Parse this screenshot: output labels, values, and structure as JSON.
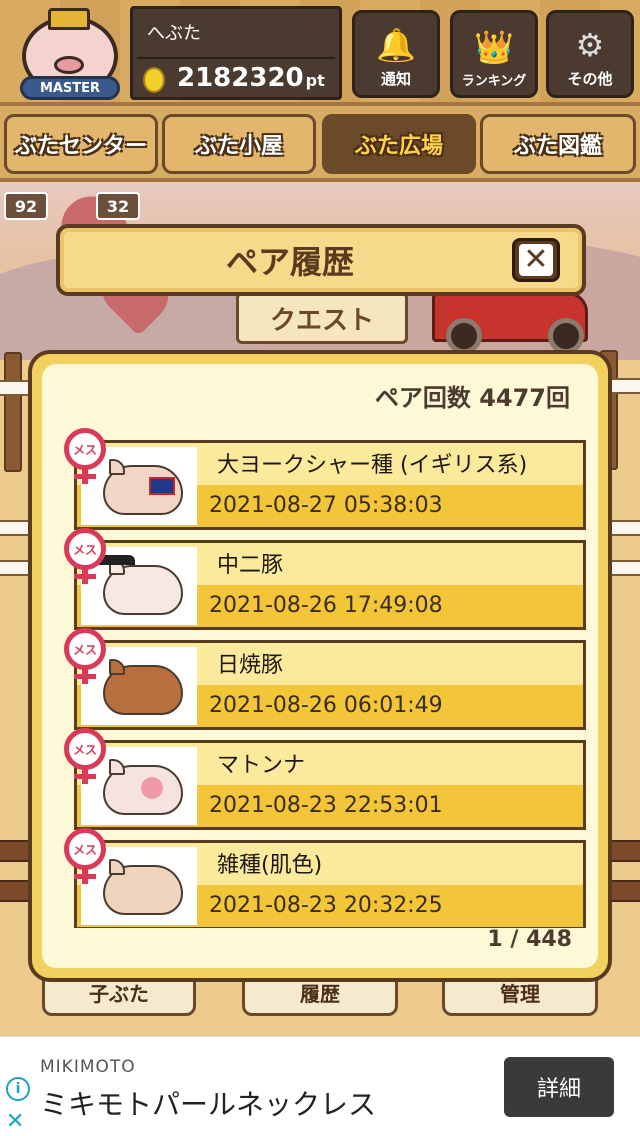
{
  "header": {
    "badge_label": "MASTER",
    "username": "へぶた",
    "points": "2182320",
    "points_unit": "pt",
    "buttons": [
      {
        "label": "通知",
        "icon": "bell-icon"
      },
      {
        "label": "ランキング",
        "icon": "crown-icon"
      },
      {
        "label": "その他",
        "icon": "gear-icon"
      }
    ]
  },
  "nav": {
    "tabs": [
      {
        "label": "ぶたセンター",
        "active": false
      },
      {
        "label": "ぶた小屋",
        "active": false
      },
      {
        "label": "ぶた広場",
        "active": true
      },
      {
        "label": "ぶた図鑑",
        "active": false
      }
    ]
  },
  "background": {
    "counter_left": "92",
    "counter_right": "32",
    "quest_sign": "クエスト",
    "bottom_buttons": [
      "子ぶた",
      "履歴",
      "管理"
    ]
  },
  "modal": {
    "title": "ペア履歴",
    "pair_count_label": "ペア回数 4477回",
    "female_mark": "メス",
    "entries": [
      {
        "name": "大ヨークシャー種 (イギリス系)",
        "date": "2021-08-27 05:38:03"
      },
      {
        "name": "中二豚",
        "date": "2021-08-26 17:49:08"
      },
      {
        "name": "日焼豚",
        "date": "2021-08-26 06:01:49"
      },
      {
        "name": "マトンナ",
        "date": "2021-08-23 22:53:01"
      },
      {
        "name": "雑種(肌色)",
        "date": "2021-08-23 20:32:25"
      }
    ],
    "pager": "1 / 448"
  },
  "ad": {
    "brand": "MIKIMOTO",
    "title": "ミキモトパールネックレス",
    "button": "詳細"
  }
}
